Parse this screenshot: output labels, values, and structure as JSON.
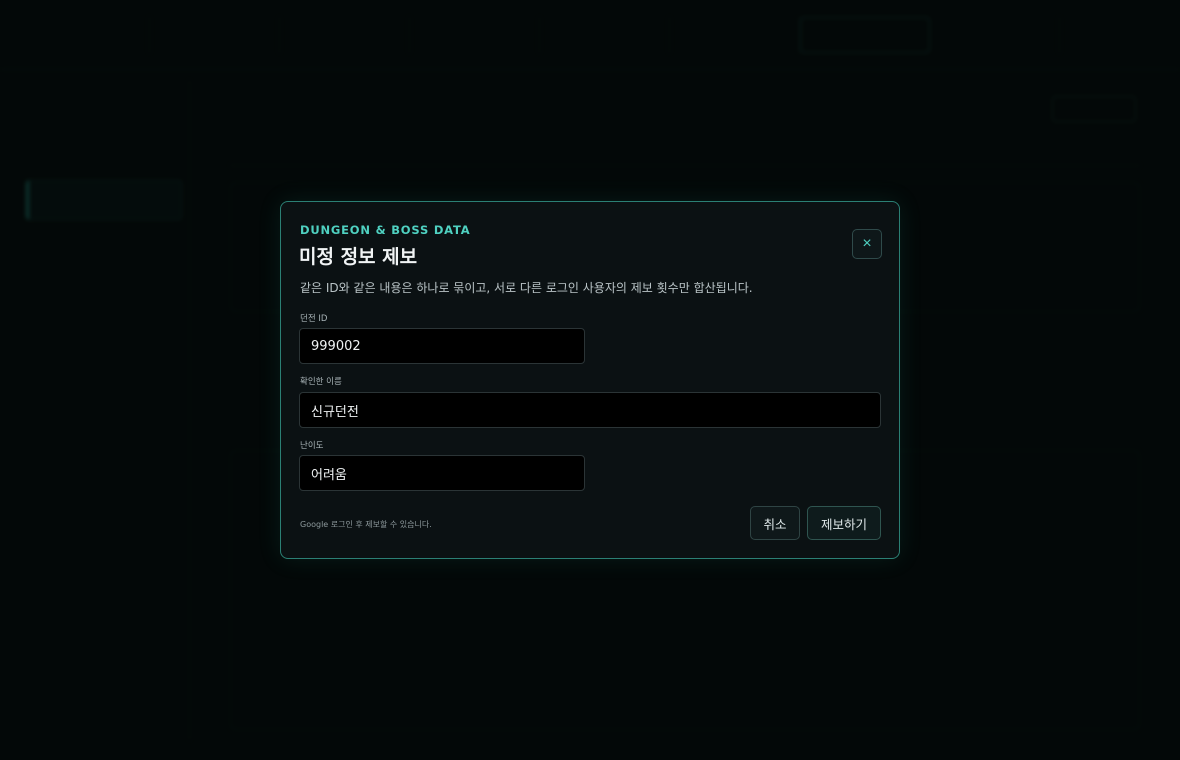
{
  "modal": {
    "kicker": "DUNGEON & BOSS DATA",
    "title": "미정 정보 제보",
    "close_icon": "×",
    "description": "같은 ID와 같은 내용은 하나로 묶이고, 서로 다른 로그인 사용자의 제보 횟수만 합산됩니다.",
    "fields": [
      {
        "label": "던전 ID",
        "value": "999002"
      },
      {
        "label": "확인한 이름",
        "value": "신규던전"
      },
      {
        "label": "난이도",
        "value": "어려움"
      }
    ],
    "note": "Google 로그인 후 제보할 수 있습니다.",
    "cancel_label": "취소",
    "submit_label": "제보하기"
  },
  "colors": {
    "accent": "#4fd1c1",
    "modal_border": "#2b7f74",
    "modal_bg": "#0b1113"
  }
}
